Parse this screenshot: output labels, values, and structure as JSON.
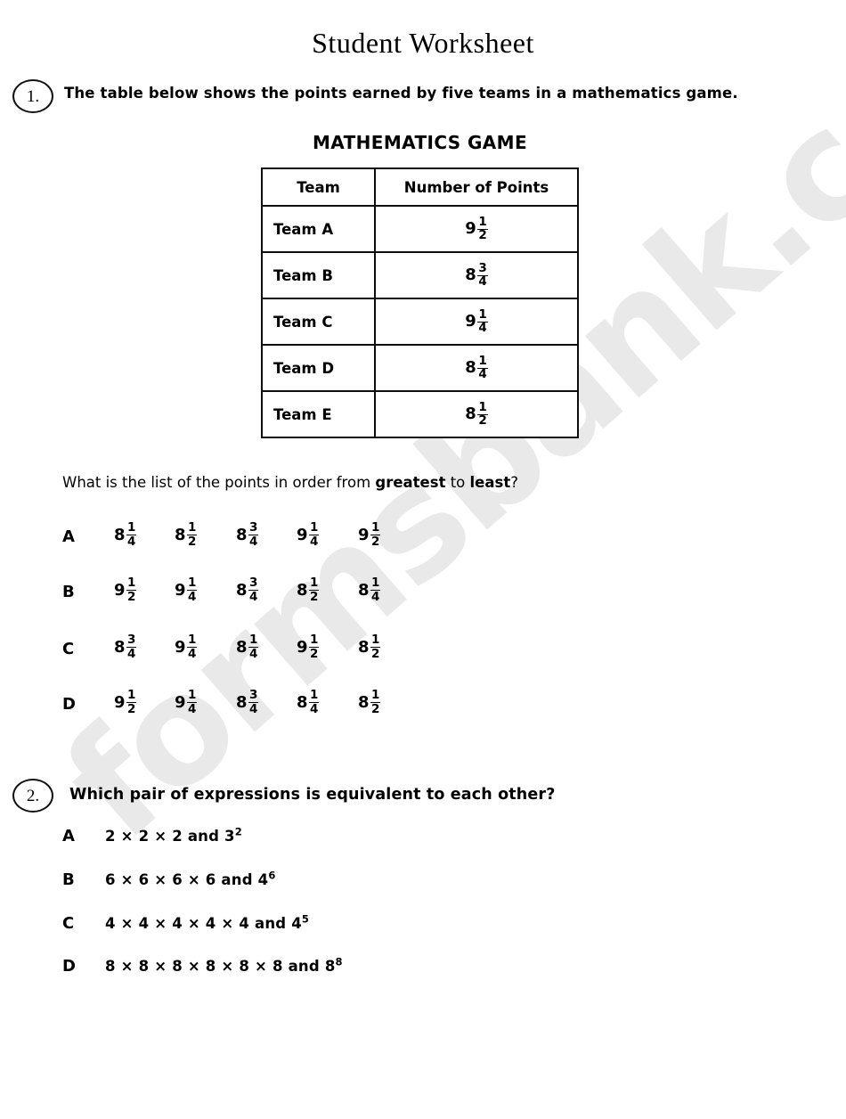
{
  "title": "Student Worksheet",
  "watermark": "formsbank.com",
  "questions": [
    {
      "number": "1.",
      "stem": "The table below shows the points earned by five teams in a mathematics game.",
      "table": {
        "caption": "MATHEMATICS GAME",
        "headers": [
          "Team",
          "Number of Points"
        ],
        "rows": [
          {
            "team": "Team A",
            "whole": "9",
            "num": "1",
            "den": "2"
          },
          {
            "team": "Team B",
            "whole": "8",
            "num": "3",
            "den": "4"
          },
          {
            "team": "Team C",
            "whole": "9",
            "num": "1",
            "den": "4"
          },
          {
            "team": "Team D",
            "whole": "8",
            "num": "1",
            "den": "4"
          },
          {
            "team": "Team E",
            "whole": "8",
            "num": "1",
            "den": "2"
          }
        ]
      },
      "prompt_parts": {
        "p1": "What is the list of the points in order from ",
        "b1": "greatest",
        "p2": " to ",
        "b2": "least",
        "p3": "?"
      },
      "options": [
        {
          "letter": "A",
          "values": [
            {
              "whole": "8",
              "num": "1",
              "den": "4"
            },
            {
              "whole": "8",
              "num": "1",
              "den": "2"
            },
            {
              "whole": "8",
              "num": "3",
              "den": "4"
            },
            {
              "whole": "9",
              "num": "1",
              "den": "4"
            },
            {
              "whole": "9",
              "num": "1",
              "den": "2"
            }
          ]
        },
        {
          "letter": "B",
          "values": [
            {
              "whole": "9",
              "num": "1",
              "den": "2"
            },
            {
              "whole": "9",
              "num": "1",
              "den": "4"
            },
            {
              "whole": "8",
              "num": "3",
              "den": "4"
            },
            {
              "whole": "8",
              "num": "1",
              "den": "2"
            },
            {
              "whole": "8",
              "num": "1",
              "den": "4"
            }
          ]
        },
        {
          "letter": "C",
          "values": [
            {
              "whole": "8",
              "num": "3",
              "den": "4"
            },
            {
              "whole": "9",
              "num": "1",
              "den": "4"
            },
            {
              "whole": "8",
              "num": "1",
              "den": "4"
            },
            {
              "whole": "9",
              "num": "1",
              "den": "2"
            },
            {
              "whole": "8",
              "num": "1",
              "den": "2"
            }
          ]
        },
        {
          "letter": "D",
          "values": [
            {
              "whole": "9",
              "num": "1",
              "den": "2"
            },
            {
              "whole": "9",
              "num": "1",
              "den": "4"
            },
            {
              "whole": "8",
              "num": "3",
              "den": "4"
            },
            {
              "whole": "8",
              "num": "1",
              "den": "4"
            },
            {
              "whole": "8",
              "num": "1",
              "den": "2"
            }
          ]
        }
      ]
    },
    {
      "number": "2.",
      "stem": "Which pair of expressions is equivalent to each other?",
      "options": [
        {
          "letter": "A",
          "base": "2 × 2 × 2 and 3",
          "exp": "2"
        },
        {
          "letter": "B",
          "base": "6 × 6 × 6 × 6 and 4",
          "exp": "6"
        },
        {
          "letter": "C",
          "base": "4 × 4 × 4 × 4 × 4 and 4",
          "exp": "5"
        },
        {
          "letter": "D",
          "base": "8 × 8 × 8 × 8 × 8 × 8 and 8",
          "exp": "8"
        }
      ]
    }
  ]
}
